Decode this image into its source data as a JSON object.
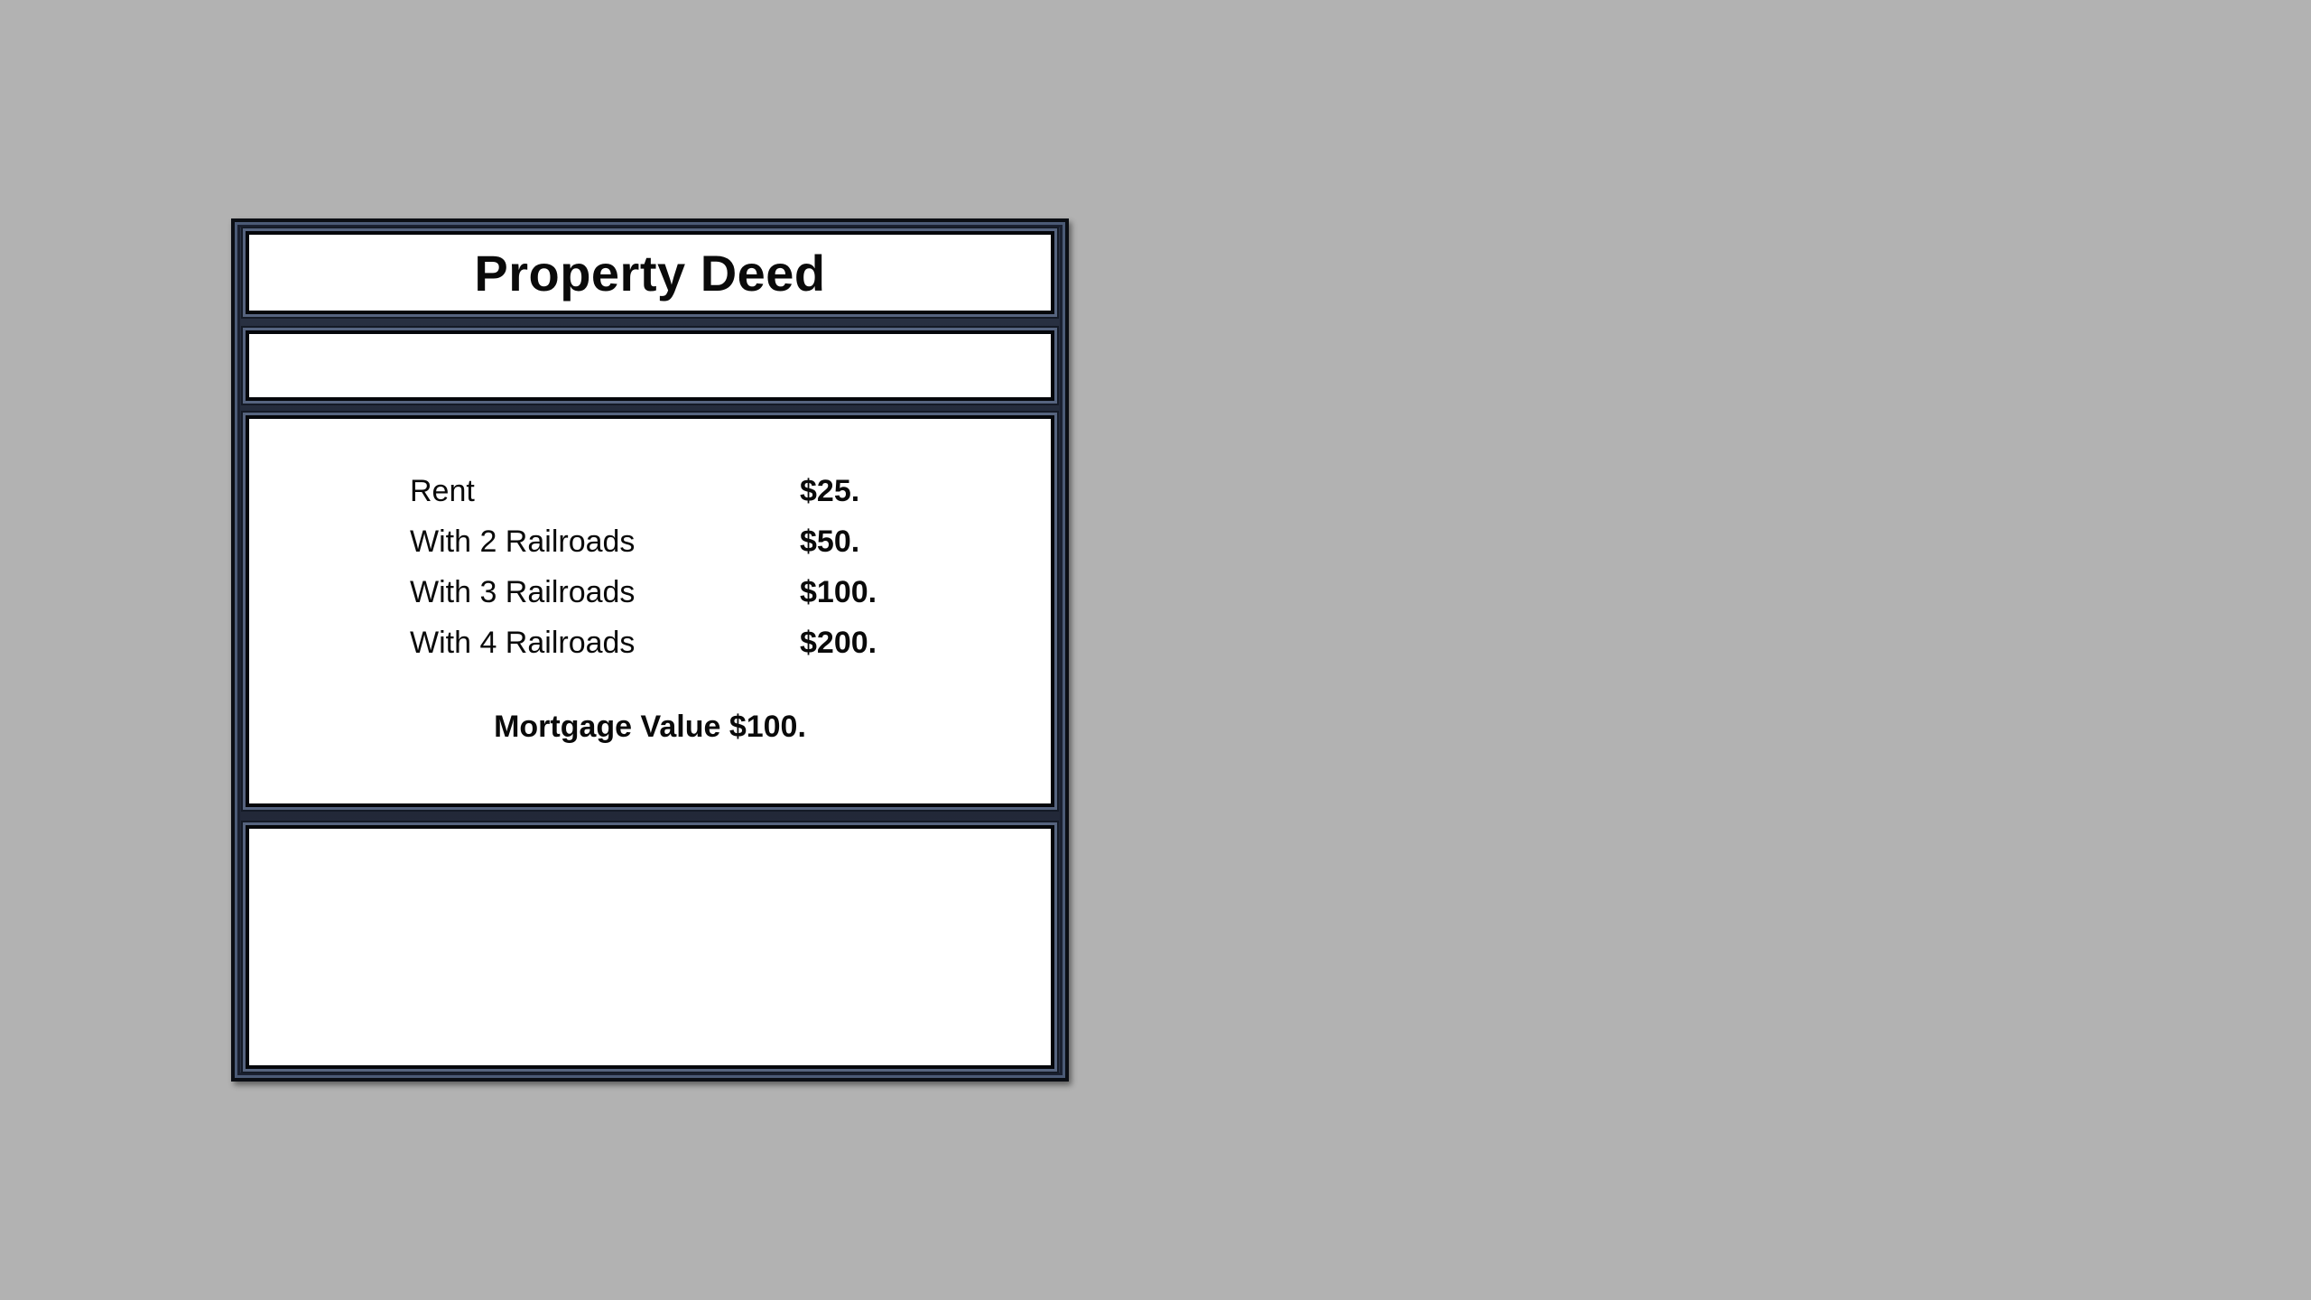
{
  "deed": {
    "title": "Property Deed",
    "subtitle": "",
    "rent_rows": [
      {
        "label": "Rent",
        "value": "$25."
      },
      {
        "label": "With 2 Railroads",
        "value": "$50."
      },
      {
        "label": "With 3 Railroads",
        "value": "$100."
      },
      {
        "label": "With 4 Railroads",
        "value": "$200."
      }
    ],
    "mortgage": "Mortgage Value $100.",
    "footer": ""
  },
  "colors": {
    "background": "#b2b2b2",
    "frame": "#1b2130",
    "panel": "#ffffff",
    "text": "#0a0a0a"
  }
}
